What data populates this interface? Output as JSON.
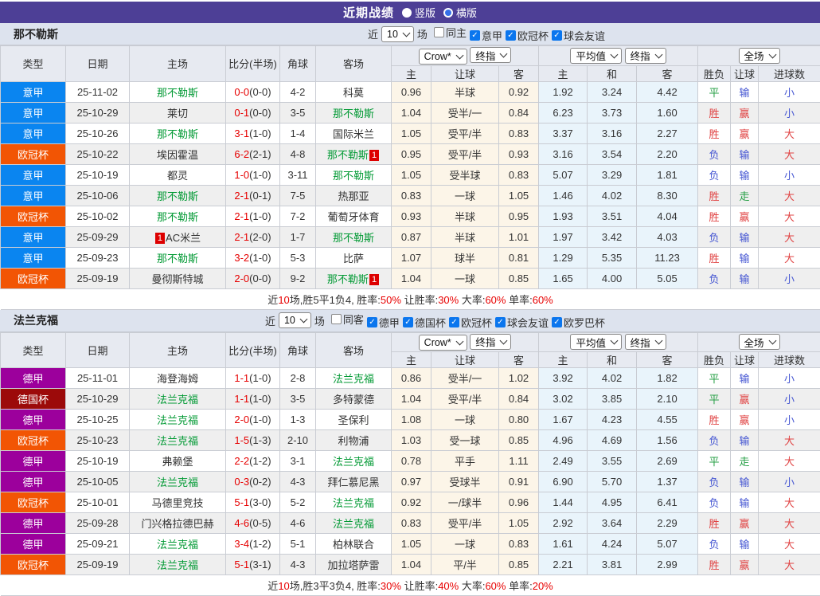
{
  "topbar": {
    "title": "近期战绩",
    "options": [
      {
        "label": "竖版",
        "selected": false
      },
      {
        "label": "横版",
        "selected": true
      }
    ]
  },
  "league_colors": {
    "意甲": "#0a85f0",
    "欧冠杯": "#f25504",
    "德甲": "#9c009c",
    "德国杯": "#9c0a0a"
  },
  "result_colors": {
    "胜": "red",
    "平": "green",
    "负": "blue",
    "赢": "red",
    "走": "green",
    "输": "blue",
    "大": "red",
    "小": "blue"
  },
  "sections": [
    {
      "team": "那不勒斯",
      "filter": {
        "near_label": "近",
        "count": "10",
        "games_label": "场",
        "checkboxes": [
          {
            "label": "同主",
            "checked": false
          },
          {
            "label": "意甲",
            "checked": true
          },
          {
            "label": "欧冠杯",
            "checked": true
          },
          {
            "label": "球会友谊",
            "checked": true
          }
        ]
      },
      "header": {
        "cols": [
          "类型",
          "日期",
          "主场",
          "比分(半场)",
          "角球",
          "客场"
        ],
        "crow_select": "Crow*",
        "crow_ref_select": "终指",
        "avg_select": "平均值",
        "avg_ref_select": "终指",
        "scope_select": "全场",
        "sub": [
          "主",
          "让球",
          "客",
          "主",
          "和",
          "客",
          "胜负",
          "让球",
          "进球数"
        ]
      },
      "rows": [
        {
          "league": "意甲",
          "date": "25-11-02",
          "home": "那不勒斯",
          "home_green": true,
          "home_card_pre": "",
          "home_card_post": "",
          "score": "0-0",
          "half": "(0-0)",
          "corner": "4-2",
          "away": "科莫",
          "away_green": false,
          "away_card_pre": "",
          "away_card_post": "",
          "w1": "0.96",
          "handicap": "半球",
          "w2": "0.92",
          "a1": "1.92",
          "a2": "3.24",
          "a3": "4.42",
          "r1": "平",
          "r2": "输",
          "r3": "小"
        },
        {
          "league": "意甲",
          "date": "25-10-29",
          "home": "莱切",
          "home_green": false,
          "home_card_pre": "",
          "home_card_post": "",
          "score": "0-1",
          "half": "(0-0)",
          "corner": "3-5",
          "away": "那不勒斯",
          "away_green": true,
          "away_card_pre": "",
          "away_card_post": "",
          "w1": "1.04",
          "handicap": "受半/一",
          "w2": "0.84",
          "a1": "6.23",
          "a2": "3.73",
          "a3": "1.60",
          "r1": "胜",
          "r2": "赢",
          "r3": "小"
        },
        {
          "league": "意甲",
          "date": "25-10-26",
          "home": "那不勒斯",
          "home_green": true,
          "home_card_pre": "",
          "home_card_post": "",
          "score": "3-1",
          "half": "(1-0)",
          "corner": "1-4",
          "away": "国际米兰",
          "away_green": false,
          "away_card_pre": "",
          "away_card_post": "",
          "w1": "1.05",
          "handicap": "受平/半",
          "w2": "0.83",
          "a1": "3.37",
          "a2": "3.16",
          "a3": "2.27",
          "r1": "胜",
          "r2": "赢",
          "r3": "大"
        },
        {
          "league": "欧冠杯",
          "date": "25-10-22",
          "home": "埃因霍温",
          "home_green": false,
          "home_card_pre": "",
          "home_card_post": "",
          "score": "6-2",
          "half": "(2-1)",
          "corner": "4-8",
          "away": "那不勒斯",
          "away_green": true,
          "away_card_pre": "",
          "away_card_post": "1",
          "w1": "0.95",
          "handicap": "受平/半",
          "w2": "0.93",
          "a1": "3.16",
          "a2": "3.54",
          "a3": "2.20",
          "r1": "负",
          "r2": "输",
          "r3": "大"
        },
        {
          "league": "意甲",
          "date": "25-10-19",
          "home": "都灵",
          "home_green": false,
          "home_card_pre": "",
          "home_card_post": "",
          "score": "1-0",
          "half": "(1-0)",
          "corner": "3-11",
          "away": "那不勒斯",
          "away_green": true,
          "away_card_pre": "",
          "away_card_post": "",
          "w1": "1.05",
          "handicap": "受半球",
          "w2": "0.83",
          "a1": "5.07",
          "a2": "3.29",
          "a3": "1.81",
          "r1": "负",
          "r2": "输",
          "r3": "小"
        },
        {
          "league": "意甲",
          "date": "25-10-06",
          "home": "那不勒斯",
          "home_green": true,
          "home_card_pre": "",
          "home_card_post": "",
          "score": "2-1",
          "half": "(0-1)",
          "corner": "7-5",
          "away": "热那亚",
          "away_green": false,
          "away_card_pre": "",
          "away_card_post": "",
          "w1": "0.83",
          "handicap": "一球",
          "w2": "1.05",
          "a1": "1.46",
          "a2": "4.02",
          "a3": "8.30",
          "r1": "胜",
          "r2": "走",
          "r3": "大"
        },
        {
          "league": "欧冠杯",
          "date": "25-10-02",
          "home": "那不勒斯",
          "home_green": true,
          "home_card_pre": "",
          "home_card_post": "",
          "score": "2-1",
          "half": "(1-0)",
          "corner": "7-2",
          "away": "葡萄牙体育",
          "away_green": false,
          "away_card_pre": "",
          "away_card_post": "",
          "w1": "0.93",
          "handicap": "半球",
          "w2": "0.95",
          "a1": "1.93",
          "a2": "3.51",
          "a3": "4.04",
          "r1": "胜",
          "r2": "赢",
          "r3": "大"
        },
        {
          "league": "意甲",
          "date": "25-09-29",
          "home": "AC米兰",
          "home_green": false,
          "home_card_pre": "1",
          "home_card_post": "",
          "score": "2-1",
          "half": "(2-0)",
          "corner": "1-7",
          "away": "那不勒斯",
          "away_green": true,
          "away_card_pre": "",
          "away_card_post": "",
          "w1": "0.87",
          "handicap": "半球",
          "w2": "1.01",
          "a1": "1.97",
          "a2": "3.42",
          "a3": "4.03",
          "r1": "负",
          "r2": "输",
          "r3": "大"
        },
        {
          "league": "意甲",
          "date": "25-09-23",
          "home": "那不勒斯",
          "home_green": true,
          "home_card_pre": "",
          "home_card_post": "",
          "score": "3-2",
          "half": "(1-0)",
          "corner": "5-3",
          "away": "比萨",
          "away_green": false,
          "away_card_pre": "",
          "away_card_post": "",
          "w1": "1.07",
          "handicap": "球半",
          "w2": "0.81",
          "a1": "1.29",
          "a2": "5.35",
          "a3": "11.23",
          "r1": "胜",
          "r2": "输",
          "r3": "大"
        },
        {
          "league": "欧冠杯",
          "date": "25-09-19",
          "home": "曼彻斯特城",
          "home_green": false,
          "home_card_pre": "",
          "home_card_post": "",
          "score": "2-0",
          "half": "(0-0)",
          "corner": "9-2",
          "away": "那不勒斯",
          "away_green": true,
          "away_card_pre": "",
          "away_card_post": "1",
          "w1": "1.04",
          "handicap": "一球",
          "w2": "0.85",
          "a1": "1.65",
          "a2": "4.00",
          "a3": "5.05",
          "r1": "负",
          "r2": "输",
          "r3": "小"
        }
      ],
      "summary": [
        {
          "t": "近",
          "r": false
        },
        {
          "t": "10",
          "r": true
        },
        {
          "t": "场,胜5平1负4, 胜率:",
          "r": false
        },
        {
          "t": "50%",
          "r": true
        },
        {
          "t": " 让胜率:",
          "r": false
        },
        {
          "t": "30%",
          "r": true
        },
        {
          "t": " 大率:",
          "r": false
        },
        {
          "t": "60%",
          "r": true
        },
        {
          "t": " 单率:",
          "r": false
        },
        {
          "t": "60%",
          "r": true
        }
      ]
    },
    {
      "team": "法兰克福",
      "filter": {
        "near_label": "近",
        "count": "10",
        "games_label": "场",
        "checkboxes": [
          {
            "label": "同客",
            "checked": false
          },
          {
            "label": "德甲",
            "checked": true
          },
          {
            "label": "德国杯",
            "checked": true
          },
          {
            "label": "欧冠杯",
            "checked": true
          },
          {
            "label": "球会友谊",
            "checked": true
          },
          {
            "label": "欧罗巴杯",
            "checked": true
          }
        ]
      },
      "header": {
        "cols": [
          "类型",
          "日期",
          "主场",
          "比分(半场)",
          "角球",
          "客场"
        ],
        "crow_select": "Crow*",
        "crow_ref_select": "终指",
        "avg_select": "平均值",
        "avg_ref_select": "终指",
        "scope_select": "全场",
        "sub": [
          "主",
          "让球",
          "客",
          "主",
          "和",
          "客",
          "胜负",
          "让球",
          "进球数"
        ]
      },
      "rows": [
        {
          "league": "德甲",
          "date": "25-11-01",
          "home": "海登海姆",
          "home_green": false,
          "home_card_pre": "",
          "home_card_post": "",
          "score": "1-1",
          "half": "(1-0)",
          "corner": "2-8",
          "away": "法兰克福",
          "away_green": true,
          "away_card_pre": "",
          "away_card_post": "",
          "w1": "0.86",
          "handicap": "受半/一",
          "w2": "1.02",
          "a1": "3.92",
          "a2": "4.02",
          "a3": "1.82",
          "r1": "平",
          "r2": "输",
          "r3": "小"
        },
        {
          "league": "德国杯",
          "date": "25-10-29",
          "home": "法兰克福",
          "home_green": true,
          "home_card_pre": "",
          "home_card_post": "",
          "score": "1-1",
          "half": "(1-0)",
          "corner": "3-5",
          "away": "多特蒙德",
          "away_green": false,
          "away_card_pre": "",
          "away_card_post": "",
          "w1": "1.04",
          "handicap": "受平/半",
          "w2": "0.84",
          "a1": "3.02",
          "a2": "3.85",
          "a3": "2.10",
          "r1": "平",
          "r2": "赢",
          "r3": "小"
        },
        {
          "league": "德甲",
          "date": "25-10-25",
          "home": "法兰克福",
          "home_green": true,
          "home_card_pre": "",
          "home_card_post": "",
          "score": "2-0",
          "half": "(1-0)",
          "corner": "1-3",
          "away": "圣保利",
          "away_green": false,
          "away_card_pre": "",
          "away_card_post": "",
          "w1": "1.08",
          "handicap": "一球",
          "w2": "0.80",
          "a1": "1.67",
          "a2": "4.23",
          "a3": "4.55",
          "r1": "胜",
          "r2": "赢",
          "r3": "小"
        },
        {
          "league": "欧冠杯",
          "date": "25-10-23",
          "home": "法兰克福",
          "home_green": true,
          "home_card_pre": "",
          "home_card_post": "",
          "score": "1-5",
          "half": "(1-3)",
          "corner": "2-10",
          "away": "利物浦",
          "away_green": false,
          "away_card_pre": "",
          "away_card_post": "",
          "w1": "1.03",
          "handicap": "受一球",
          "w2": "0.85",
          "a1": "4.96",
          "a2": "4.69",
          "a3": "1.56",
          "r1": "负",
          "r2": "输",
          "r3": "大"
        },
        {
          "league": "德甲",
          "date": "25-10-19",
          "home": "弗赖堡",
          "home_green": false,
          "home_card_pre": "",
          "home_card_post": "",
          "score": "2-2",
          "half": "(1-2)",
          "corner": "3-1",
          "away": "法兰克福",
          "away_green": true,
          "away_card_pre": "",
          "away_card_post": "",
          "w1": "0.78",
          "handicap": "平手",
          "w2": "1.11",
          "a1": "2.49",
          "a2": "3.55",
          "a3": "2.69",
          "r1": "平",
          "r2": "走",
          "r3": "大"
        },
        {
          "league": "德甲",
          "date": "25-10-05",
          "home": "法兰克福",
          "home_green": true,
          "home_card_pre": "",
          "home_card_post": "",
          "score": "0-3",
          "half": "(0-2)",
          "corner": "4-3",
          "away": "拜仁慕尼黑",
          "away_green": false,
          "away_card_pre": "",
          "away_card_post": "",
          "w1": "0.97",
          "handicap": "受球半",
          "w2": "0.91",
          "a1": "6.90",
          "a2": "5.70",
          "a3": "1.37",
          "r1": "负",
          "r2": "输",
          "r3": "小"
        },
        {
          "league": "欧冠杯",
          "date": "25-10-01",
          "home": "马德里竞技",
          "home_green": false,
          "home_card_pre": "",
          "home_card_post": "",
          "score": "5-1",
          "half": "(3-0)",
          "corner": "5-2",
          "away": "法兰克福",
          "away_green": true,
          "away_card_pre": "",
          "away_card_post": "",
          "w1": "0.92",
          "handicap": "一/球半",
          "w2": "0.96",
          "a1": "1.44",
          "a2": "4.95",
          "a3": "6.41",
          "r1": "负",
          "r2": "输",
          "r3": "大"
        },
        {
          "league": "德甲",
          "date": "25-09-28",
          "home": "门兴格拉德巴赫",
          "home_green": false,
          "home_card_pre": "",
          "home_card_post": "",
          "score": "4-6",
          "half": "(0-5)",
          "corner": "4-6",
          "away": "法兰克福",
          "away_green": true,
          "away_card_pre": "",
          "away_card_post": "",
          "w1": "0.83",
          "handicap": "受平/半",
          "w2": "1.05",
          "a1": "2.92",
          "a2": "3.64",
          "a3": "2.29",
          "r1": "胜",
          "r2": "赢",
          "r3": "大"
        },
        {
          "league": "德甲",
          "date": "25-09-21",
          "home": "法兰克福",
          "home_green": true,
          "home_card_pre": "",
          "home_card_post": "",
          "score": "3-4",
          "half": "(1-2)",
          "corner": "5-1",
          "away": "柏林联合",
          "away_green": false,
          "away_card_pre": "",
          "away_card_post": "",
          "w1": "1.05",
          "handicap": "一球",
          "w2": "0.83",
          "a1": "1.61",
          "a2": "4.24",
          "a3": "5.07",
          "r1": "负",
          "r2": "输",
          "r3": "大"
        },
        {
          "league": "欧冠杯",
          "date": "25-09-19",
          "home": "法兰克福",
          "home_green": true,
          "home_card_pre": "",
          "home_card_post": "",
          "score": "5-1",
          "half": "(3-1)",
          "corner": "4-3",
          "away": "加拉塔萨雷",
          "away_green": false,
          "away_card_pre": "",
          "away_card_post": "",
          "w1": "1.04",
          "handicap": "平/半",
          "w2": "0.85",
          "a1": "2.21",
          "a2": "3.81",
          "a3": "2.99",
          "r1": "胜",
          "r2": "赢",
          "r3": "大"
        }
      ],
      "summary": [
        {
          "t": "近",
          "r": false
        },
        {
          "t": "10",
          "r": true
        },
        {
          "t": "场,胜3平3负4, 胜率:",
          "r": false
        },
        {
          "t": "30%",
          "r": true
        },
        {
          "t": " 让胜率:",
          "r": false
        },
        {
          "t": "40%",
          "r": true
        },
        {
          "t": " 大率:",
          "r": false
        },
        {
          "t": "60%",
          "r": true
        },
        {
          "t": " 单率:",
          "r": false
        },
        {
          "t": "20%",
          "r": true
        }
      ]
    }
  ]
}
